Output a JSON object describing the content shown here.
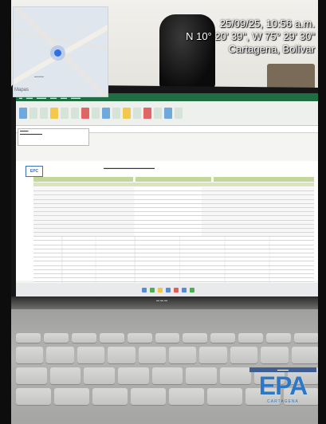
{
  "geotag": {
    "datetime": "25/09/25, 10:56 a.m.",
    "coordinates": "N 10° 20' 39\", W 75° 29' 30\"",
    "location": "Cartagena, Bolívar"
  },
  "map": {
    "label": "Mapas"
  },
  "logos": {
    "epa_main": "EPA",
    "epa_sub": "CARTAGENA"
  },
  "spreadsheet": {
    "logo": "EPC"
  }
}
